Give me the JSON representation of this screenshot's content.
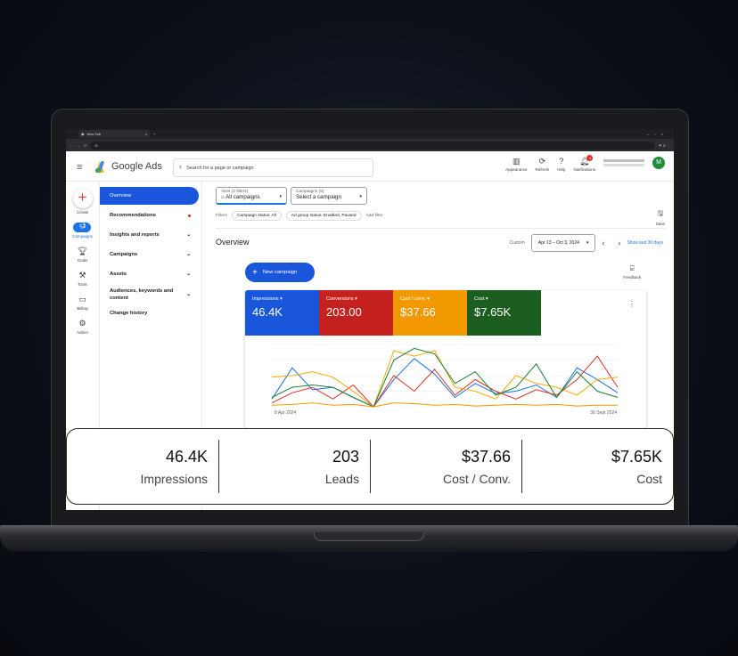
{
  "browser": {
    "tab_title": "New Tab",
    "url": "G"
  },
  "app": {
    "name": "Google Ads",
    "search_placeholder": "Search for a page or campaign"
  },
  "top_icons": [
    {
      "label": "Appearance",
      "icon": "appearance-icon",
      "glyph": "▥"
    },
    {
      "label": "Refresh",
      "icon": "refresh-icon",
      "glyph": "⟳"
    },
    {
      "label": "Help",
      "icon": "help-icon",
      "glyph": "?"
    },
    {
      "label": "Notifications",
      "icon": "bell-icon",
      "glyph": "🔔︎",
      "badge": "1"
    }
  ],
  "account": {
    "initial": "M"
  },
  "rail": [
    {
      "label": "Create",
      "glyph": "+"
    },
    {
      "label": "Campaigns",
      "glyph": "📢︎"
    },
    {
      "label": "Goals",
      "glyph": "🏆︎"
    },
    {
      "label": "Tools",
      "glyph": "⚒"
    },
    {
      "label": "Billing",
      "glyph": "▭"
    },
    {
      "label": "Admin",
      "glyph": "⚙"
    }
  ],
  "nav": [
    {
      "label": "Overview",
      "active": true
    },
    {
      "label": "Recommendations",
      "dot": true
    },
    {
      "label": "Insights and reports",
      "chevron": "⌄"
    },
    {
      "label": "Campaigns",
      "chevron": "⌄"
    },
    {
      "label": "Assets",
      "chevron": "⌄"
    },
    {
      "label": "Audiences, keywords and content",
      "chevron": "⌄"
    },
    {
      "label": "Change history"
    }
  ],
  "view_filter": {
    "label": "View (2 filters)",
    "value": "All campaigns"
  },
  "campaign_filter": {
    "label": "Campaigns (5)",
    "value": "Select a campaign"
  },
  "filters": {
    "label": "Filters",
    "chips": [
      "Campaign status: All",
      "Ad group status: Enabled, Paused"
    ],
    "add": "Add filter"
  },
  "save_label": "Save",
  "overview_title": "Overview",
  "date": {
    "mode": "Custom",
    "range": "Apr 13 – Oct 3, 2024",
    "show": "Show last 30 days"
  },
  "new_campaign": "New campaign",
  "feedback": "Feedback",
  "metrics": [
    {
      "label": "Impressions ▾",
      "value": "46.4K",
      "color": "#1a56db"
    },
    {
      "label": "Conversions ▾",
      "value": "203.00",
      "color": "#c5221f"
    },
    {
      "label": "Cost / conv. ▾",
      "value": "$37.66",
      "color": "#f29900"
    },
    {
      "label": "Cost ▾",
      "value": "$7.65K",
      "color": "#1b5e20"
    }
  ],
  "chart_data": {
    "type": "line",
    "x_labels": [
      "8 Apr 2024",
      "30 Sept 2024"
    ],
    "series": [
      {
        "color": "#1a73e8",
        "values": [
          10,
          50,
          22,
          25,
          12,
          0,
          35,
          62,
          42,
          12,
          30,
          17,
          20,
          28,
          12,
          50,
          35,
          18
        ]
      },
      {
        "color": "#d93025",
        "values": [
          5,
          18,
          25,
          10,
          28,
          0,
          40,
          20,
          48,
          15,
          35,
          20,
          10,
          22,
          15,
          35,
          65,
          25
        ]
      },
      {
        "color": "#f9ab00",
        "values": [
          38,
          40,
          45,
          38,
          20,
          0,
          72,
          65,
          72,
          25,
          20,
          10,
          40,
          30,
          25,
          15,
          35,
          38
        ]
      },
      {
        "color": "#188038",
        "values": [
          12,
          25,
          28,
          25,
          12,
          0,
          60,
          75,
          68,
          30,
          45,
          15,
          25,
          55,
          12,
          45,
          20,
          12
        ]
      },
      {
        "color": "#f29900",
        "values": [
          2,
          3,
          5,
          2,
          3,
          0,
          5,
          4,
          2,
          3,
          1,
          2,
          3,
          2,
          3,
          1,
          2,
          2
        ]
      }
    ]
  },
  "summary": [
    {
      "value": "46.4K",
      "label": "Impressions"
    },
    {
      "value": "203",
      "label": "Leads"
    },
    {
      "value": "$37.66",
      "label": "Cost / Conv."
    },
    {
      "value": "$7.65K",
      "label": "Cost"
    }
  ]
}
